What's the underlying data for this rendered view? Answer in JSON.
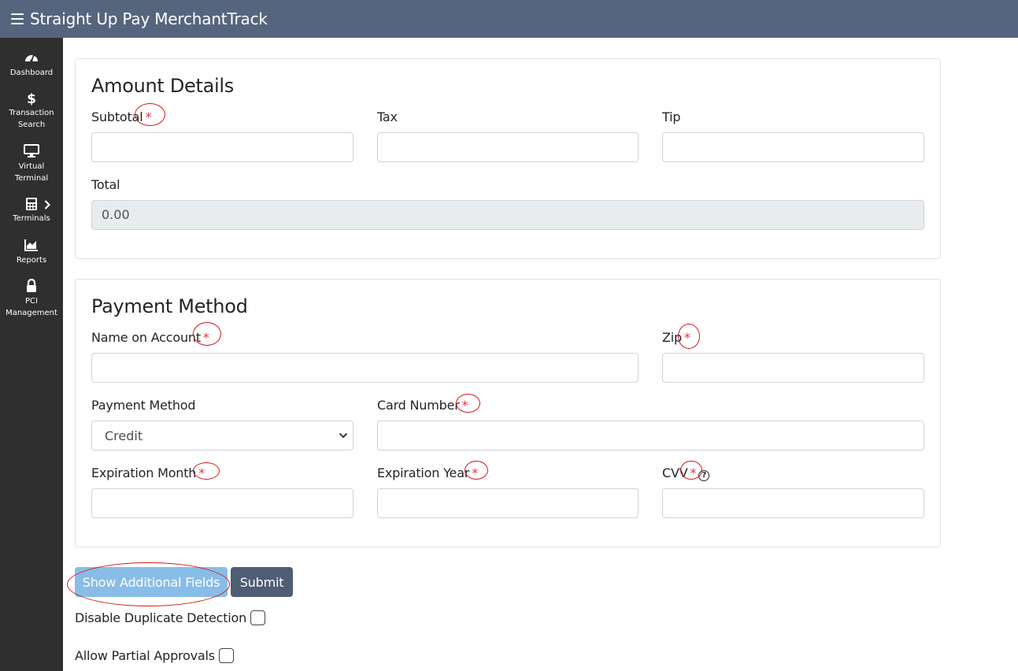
{
  "header": {
    "title": "Straight Up Pay MerchantTrack"
  },
  "sidebar": {
    "items": [
      {
        "icon": "speedometer-icon",
        "label": "Dashboard"
      },
      {
        "icon": "dollar-icon",
        "label": "Transaction Search"
      },
      {
        "icon": "monitor-icon",
        "label": "Virtual Terminal"
      },
      {
        "icon": "calculator-icon",
        "label": "Terminals"
      },
      {
        "icon": "chart-icon",
        "label": "Reports"
      },
      {
        "icon": "lock-icon",
        "label": "PCI Management"
      }
    ]
  },
  "amount_details": {
    "title": "Amount Details",
    "subtotal_label": "Subtotal",
    "tax_label": "Tax",
    "tip_label": "Tip",
    "total_label": "Total",
    "total_value": "0.00",
    "required_mark": "*"
  },
  "payment_method": {
    "title": "Payment Method",
    "name_label": "Name on Account",
    "zip_label": "Zip",
    "method_label": "Payment Method",
    "method_selected": "Credit",
    "card_label": "Card Number",
    "exp_month_label": "Expiration Month",
    "exp_year_label": "Expiration Year",
    "cvv_label": "CVV",
    "cvv_help": "?",
    "required_mark": "*"
  },
  "actions": {
    "show_fields_label": "Show Additional Fields",
    "submit_label": "Submit",
    "disable_duplicate_label": "Disable Duplicate Detection",
    "allow_partial_label": "Allow Partial Approvals"
  },
  "colors": {
    "header": "#56657e",
    "sidebar": "#2f2f2f",
    "required": "#dc3545",
    "annotation": "#d41a1a"
  }
}
